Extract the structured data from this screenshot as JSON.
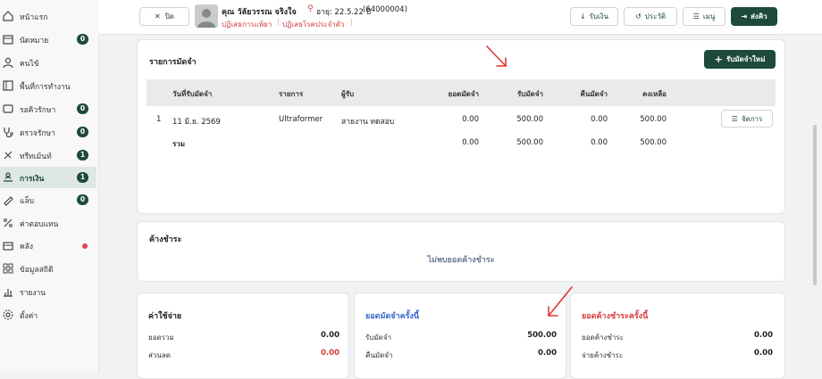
{
  "sidebar": {
    "items": [
      {
        "label": "หน้าแรก",
        "icon": "home-icon"
      },
      {
        "label": "นัดหมาย",
        "icon": "calendar-icon",
        "badge": "0"
      },
      {
        "label": "คนไข้",
        "icon": "person-icon"
      },
      {
        "label": "พื้นที่การทำงาน",
        "icon": "workspace-icon"
      },
      {
        "label": "รอคิวรักษา",
        "icon": "queue-icon",
        "badge": "0"
      },
      {
        "label": "ตรวจรักษา",
        "icon": "stethoscope-icon",
        "badge": "0"
      },
      {
        "label": "ทรีทเม้นท์",
        "icon": "treatment-icon",
        "badge": "1"
      },
      {
        "label": "การเงิน",
        "icon": "money-icon",
        "badge": "1"
      },
      {
        "label": "แล็บ",
        "icon": "lab-icon",
        "badge": "0"
      },
      {
        "label": "ค่าตอบแทน",
        "icon": "percent-icon"
      },
      {
        "label": "คลัง",
        "icon": "box-icon"
      },
      {
        "label": "ข้อมูลสถิติ",
        "icon": "grid-icon"
      },
      {
        "label": "รายงาน",
        "icon": "bar-chart-icon"
      },
      {
        "label": "ตั้งค่า",
        "icon": "gear-icon"
      }
    ]
  },
  "topbar": {
    "close_label": "ปิด",
    "patient_name": "คุณ วัลัยวรรณ จริงใจ",
    "age": "อายุ: 22.5.22 ปี",
    "hn": "(64000004)",
    "allergy_drug": "ปฏิเสธการแพ้ยา",
    "allergy_disease": "ปฏิเสธโรคประจำตัว",
    "receive_label": "รับเงิน",
    "history_label": "ประวัติ",
    "menu_label": "เมนู",
    "send_queue_label": "ส่งคิว"
  },
  "deposits": {
    "title": "รายการมัดจำ",
    "add_label": "รับมัดจำใหม่",
    "headers": [
      "วันที่รับมัดจำ",
      "รายการ",
      "ผู้รับ",
      "ยอดมัดจำ",
      "รับมัดจำ",
      "คืนมัดจำ",
      "คงเหลือ"
    ],
    "row": {
      "no": "1",
      "date": "11 มิ.ย. 2569",
      "item": "Ultraformer",
      "receiver": "สายงาน ทดสอบ",
      "deposit": "0.00",
      "received": "500.00",
      "refund": "0.00",
      "remaining": "500.00",
      "manage_label": "จัดการ"
    },
    "total": {
      "label": "รวม",
      "deposit": "0.00",
      "received": "500.00",
      "refund": "0.00",
      "remaining": "500.00"
    }
  },
  "outstanding": {
    "title": "ค้างชำระ",
    "empty": "ไม่พบยอดค้างชำระ"
  },
  "expenses": {
    "title": "ค่าใช้จ่าย",
    "total_label": "ยอดรวม",
    "total": "0.00",
    "discount_label": "ส่วนลด",
    "discount": "0.00"
  },
  "deposit_this": {
    "title": "ยอดมัดจำครั้งนี้",
    "received_label": "รับมัดจำ",
    "received": "500.00",
    "refund_label": "คืนมัดจำ",
    "refund": "0.00"
  },
  "due_this": {
    "title": "ยอดค้างชำระครั้งนี้",
    "due_label": "ยอดค้างชำระ",
    "due": "0.00",
    "paid_label": "จ่ายค้างชำระ",
    "paid": "0.00"
  },
  "colors": {
    "primary": "#1d4a3a",
    "danger": "#d63b3b",
    "link": "#3466c9",
    "annotation": "#e0362f"
  }
}
